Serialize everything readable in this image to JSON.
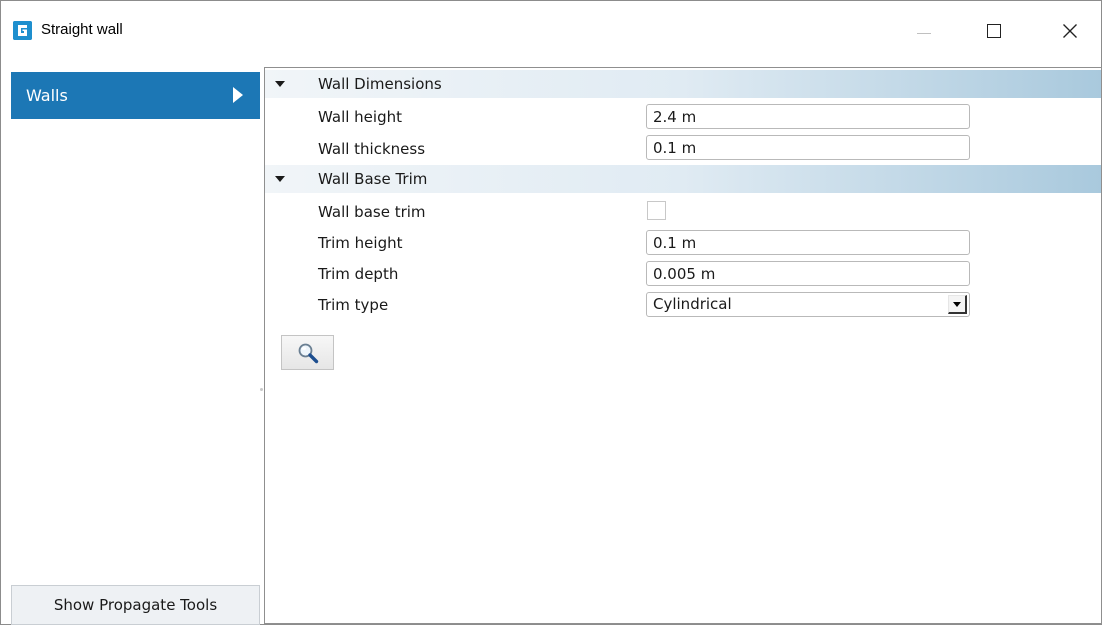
{
  "window": {
    "title": "Straight wall",
    "icon": "app-logo-icon"
  },
  "title_bar": {
    "minimize_icon": "minimize-icon",
    "maximize_icon": "maximize-icon",
    "close_icon": "close-icon"
  },
  "sidebar": {
    "items": [
      {
        "label": "Walls",
        "selected": true
      }
    ],
    "propagate_button": "Show Propagate Tools"
  },
  "properties": {
    "sections": [
      {
        "title": "Wall Dimensions",
        "expanded": true,
        "rows": [
          {
            "label": "Wall height",
            "value": "2.4 m"
          },
          {
            "label": "Wall thickness",
            "value": "0.1 m"
          }
        ]
      },
      {
        "title": "Wall Base Trim",
        "expanded": true,
        "rows": [
          {
            "label": "Wall base trim",
            "checked": false
          },
          {
            "label": "Trim height",
            "value": "0.1 m"
          },
          {
            "label": "Trim depth",
            "value": "0.005 m"
          },
          {
            "label": "Trim type",
            "value": "Cylindrical"
          }
        ]
      }
    ],
    "search_button_icon": "magnifier-icon"
  },
  "colors": {
    "accent": "#1c77b5",
    "header_gradient_end": "#a9c9dd"
  }
}
